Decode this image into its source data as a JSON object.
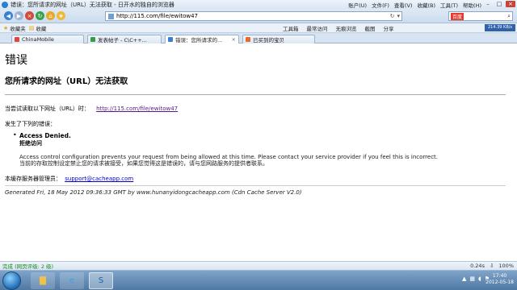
{
  "window": {
    "title": "错误：您所请求的网址（URL）无法获取 - 日开水的独自的浏览器",
    "menus": [
      "账户(U)",
      "文件(F)",
      "查看(V)",
      "收藏(B)",
      "工具(T)",
      "帮助(H)"
    ]
  },
  "toolbar": {
    "address": "http://115.com/file/ewitow47",
    "search_engine": "百度",
    "icons": [
      "back-icon",
      "forward-icon",
      "stop-icon",
      "refresh-icon",
      "home-icon",
      "favorite-star-icon"
    ]
  },
  "favorites_bar": {
    "left_items": [
      "收藏夹",
      "收藏"
    ],
    "right_items": [
      "工具箱",
      "最常访问",
      "无痕浏览",
      "截图",
      "分享"
    ],
    "speed": "214.39 KB/s"
  },
  "tabs": [
    {
      "label": "ChinaMobile",
      "color": "#d84a3a",
      "active": false
    },
    {
      "label": "发表帖子 - C\\C++...",
      "color": "#3a9a4a",
      "active": false
    },
    {
      "label": "错误：您所请求的...",
      "color": "#3a7fd0",
      "active": true
    },
    {
      "label": "已买到的宝贝",
      "color": "#e86a2a",
      "active": false
    }
  ],
  "page": {
    "heading": "错误",
    "subheading": "您所请求的网址（URL）无法获取",
    "tried_text": "当尝试读取以下网址（URL）时：",
    "tried_url": "http://115.com/file/ewitow47",
    "error_intro": "发生了下列的错误：",
    "error_title": "Access Denied.",
    "error_title_cn": "拒绝访问",
    "error_desc_en": "Access control configuration prevents your request from being allowed at this time. Please contact your service provider if you feel this is incorrect.",
    "error_desc_cn": "当前的存取控制设定禁止您的请求被接受，如果您觉得这是错误的，请与您网路服务的提供者联系。",
    "admin_text": "本缓存服务器管理员：",
    "admin_email": "support@cacheapp.com",
    "generated": "Generated Fri, 18 May 2012 09:36:33 GMT by www.hunanyidongcacheapp.com (Cdn Cache Server V2.0)"
  },
  "statusbar": {
    "status": "完成 (网页评级: 2 级)",
    "load_time": "0.24s",
    "zoom": "100%"
  },
  "taskbar": {
    "time": "17:40",
    "date": "2012-05-18"
  }
}
